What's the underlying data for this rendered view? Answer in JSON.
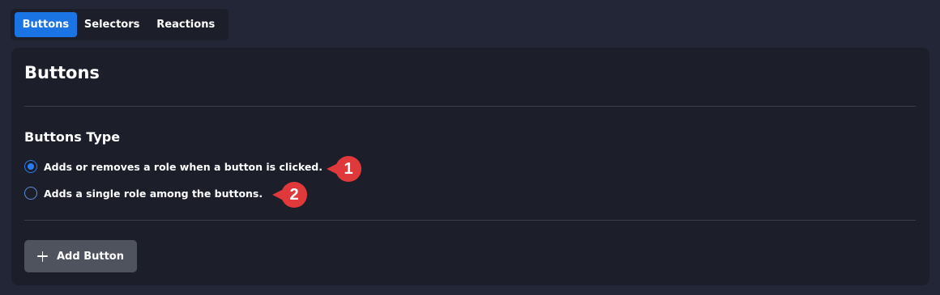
{
  "tabs": [
    {
      "label": "Buttons",
      "active": true
    },
    {
      "label": "Selectors",
      "active": false
    },
    {
      "label": "Reactions",
      "active": false
    }
  ],
  "panel": {
    "title": "Buttons",
    "section_title": "Buttons Type",
    "radio_options": [
      {
        "label": "Adds or removes a role when a button is clicked.",
        "checked": true
      },
      {
        "label": "Adds a single role among the buttons.",
        "checked": false
      }
    ],
    "add_button": {
      "label": "Add Button",
      "icon": "plus-icon"
    }
  },
  "annotations": [
    {
      "number": "1"
    },
    {
      "number": "2"
    }
  ],
  "colors": {
    "background": "#232637",
    "panel": "#1c1e29",
    "accent": "#1b74e4",
    "button": "#4f535d",
    "callout": "#e0393b"
  }
}
